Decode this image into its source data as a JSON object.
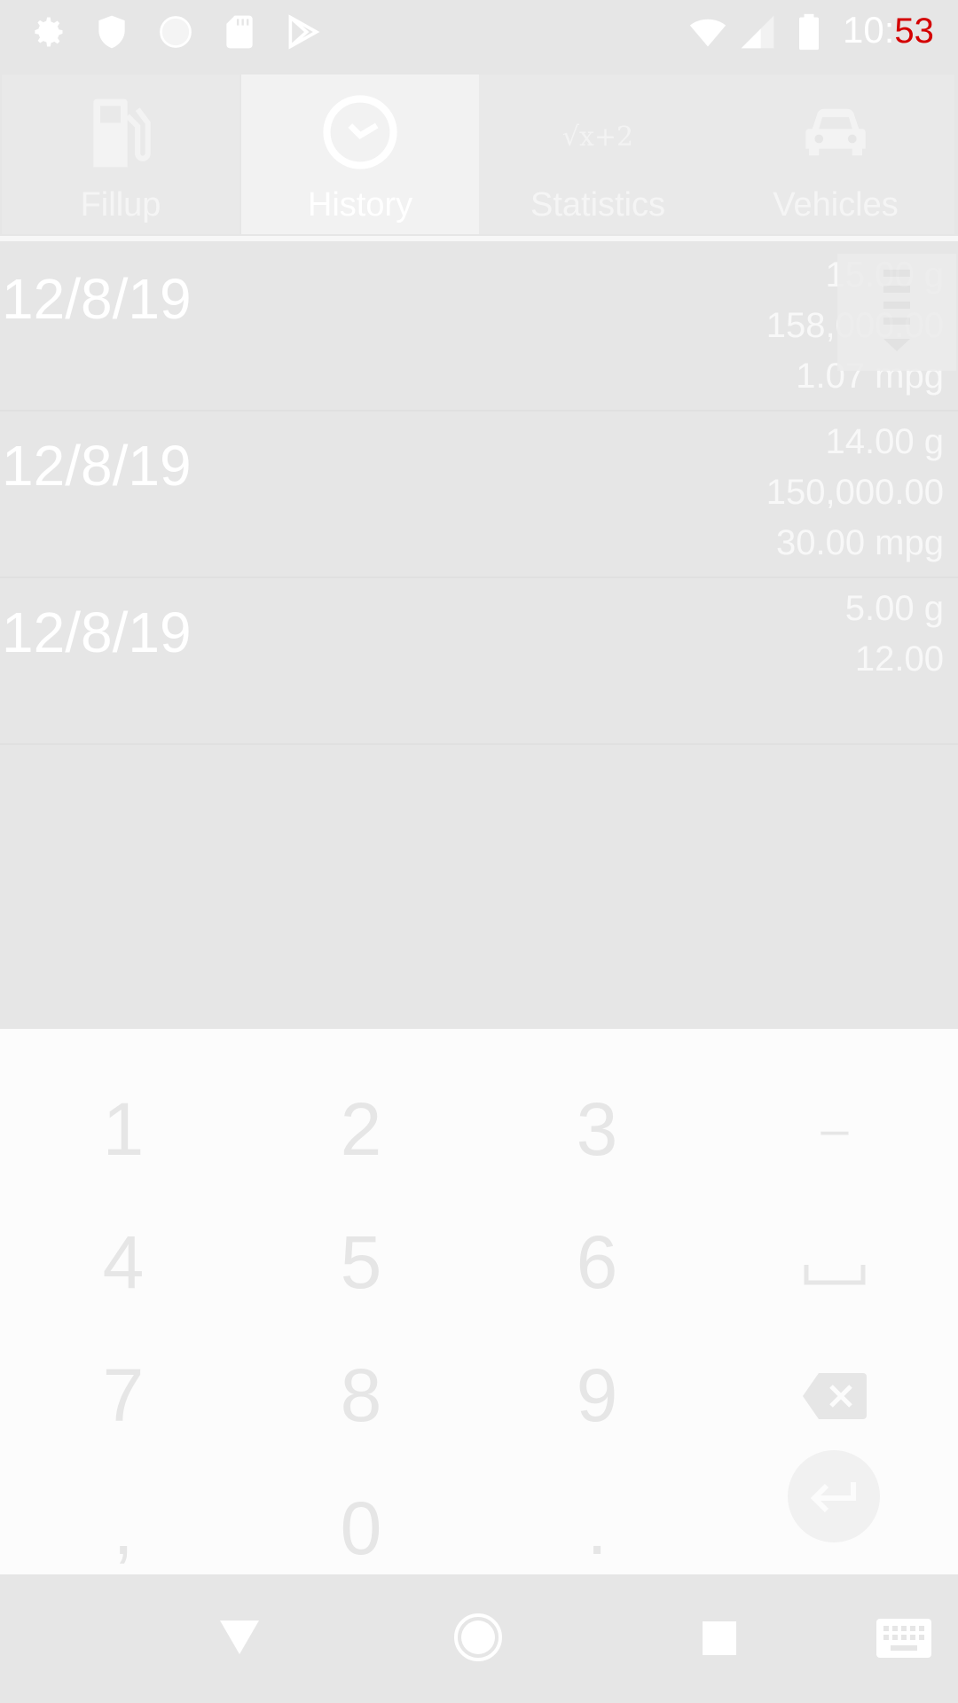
{
  "status_bar": {
    "time_prefix": "10:",
    "time_suffix": "53",
    "icons": [
      "gear-icon",
      "shield-icon",
      "circle-icon",
      "sdcard-icon",
      "play-store-icon",
      "wifi-icon",
      "signal-icon",
      "battery-icon"
    ]
  },
  "tabs": [
    {
      "label": "Fillup",
      "icon": "fuel-pump-icon",
      "active": false
    },
    {
      "label": "History",
      "icon": "clock-icon",
      "active": true
    },
    {
      "label": "Statistics",
      "icon": "formula-icon",
      "active": false
    },
    {
      "label": "Vehicles",
      "icon": "car-icon",
      "active": false
    }
  ],
  "history": {
    "rows": [
      {
        "date": "12/8/19",
        "gallons": "15.00 g",
        "odometer": "158,000.00",
        "mpg": "1.07 mpg"
      },
      {
        "date": "12/8/19",
        "gallons": "14.00 g",
        "odometer": "150,000.00",
        "mpg": "30.00 mpg"
      },
      {
        "date": "12/8/19",
        "gallons": "5.00 g",
        "odometer": "12.00",
        "mpg": ""
      }
    ]
  },
  "keyboard": {
    "keys": [
      "1",
      "2",
      "3",
      "–",
      "4",
      "5",
      "6",
      "␣",
      "7",
      "8",
      "9",
      "⌫",
      ",",
      "0",
      ".",
      "↵"
    ]
  },
  "colors": {
    "background": "#e6e6e6",
    "keyboard_bg": "#fcfcfc",
    "text_white": "#ffffff",
    "clock_red": "#d40000"
  }
}
